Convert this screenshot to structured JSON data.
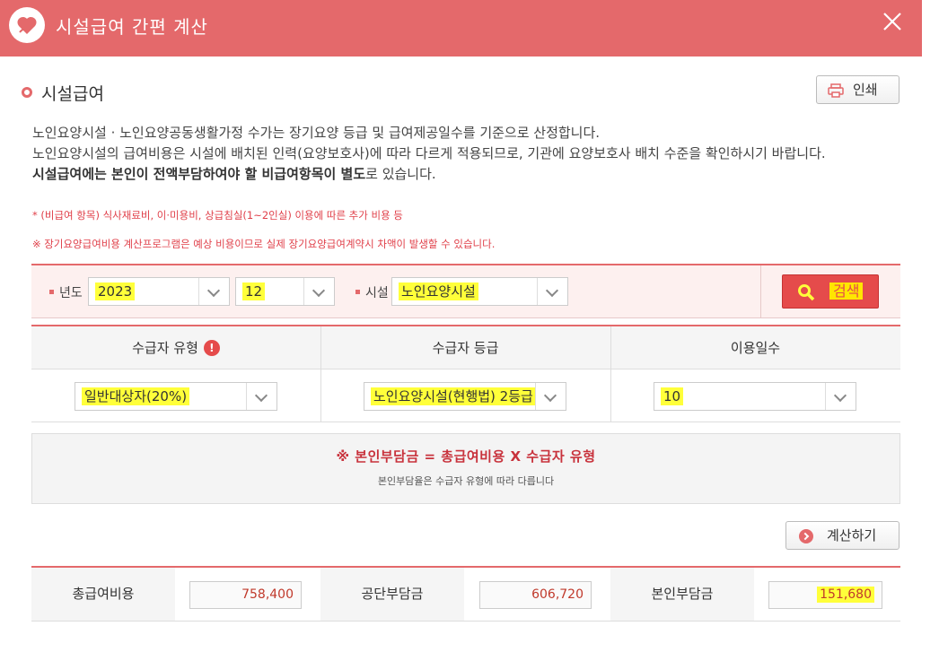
{
  "window": {
    "title": "시설급여 간편 계산"
  },
  "section": {
    "title": "시설급여",
    "print_label": "인쇄"
  },
  "description": {
    "line1": "노인요양시설 · 노인요양공동생활가정 수가는 장기요양 등급 및 급여제공일수를 기준으로 산정합니다.",
    "line2": "노인요양시설의 급여비용은 시설에 배치된 인력(요양보호사)에 따라 다르게 적용되므로, 기관에 요양보호사 배치 수준을 확인하시기 바랍니다.",
    "line3_bold": "시설급여에는 본인이 전액부담하여야 할 비급여항목이 별도",
    "line3_rest": "로 있습니다.",
    "note1": "* (비급여 항목) 식사재료비, 이·미용비, 상급침실(1~2인실) 이용에 따른 추가 비용 등",
    "note2": "※ 장기요양급여비용 계산프로그램은 예상 비용이므로 실제 장기요양급여계약시 차액이 발생할 수 있습니다."
  },
  "search": {
    "year_label": "년도",
    "year_value": "2023",
    "month_value": "12",
    "facility_label": "시설",
    "facility_value": "노인요양시설",
    "button_label": "검색"
  },
  "table": {
    "headers": [
      "수급자 유형",
      "수급자 등급",
      "이용일수"
    ],
    "recipient_type": "일반대상자(20%)",
    "recipient_grade": "노인요양시설(현행법) 2등급",
    "days": "10"
  },
  "formula": {
    "main": "※ 본인부담금 = 총급여비용 X 수급자 유형",
    "sub": "본인부담율은 수급자 유형에 따라 다릅니다"
  },
  "calc_button": "계산하기",
  "result": {
    "total_label": "총급여비용",
    "total_value": "758,400",
    "public_label": "공단부담금",
    "public_value": "606,720",
    "self_label": "본인부담금",
    "self_value": "151,680"
  },
  "colors": {
    "accent": "#e4696b",
    "button": "#e54b4b",
    "highlight": "#ffff3a"
  }
}
